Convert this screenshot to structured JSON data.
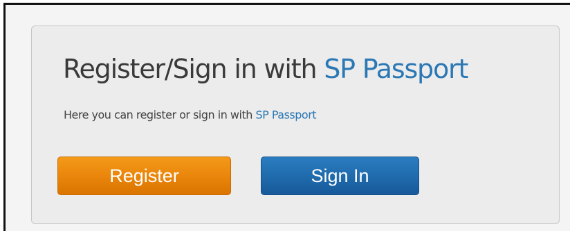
{
  "title": {
    "prefix": "Register/Sign in with ",
    "brand": "SP Passport"
  },
  "subtitle": {
    "prefix": "Here you can register or sign in with ",
    "brand": "SP Passport"
  },
  "buttons": {
    "register_label": "Register",
    "signin_label": "Sign In"
  },
  "colors": {
    "brand_link": "#2b78b4",
    "register_button": "#e9840a",
    "signin_button": "#1f6aab",
    "panel_background": "#ececec"
  }
}
